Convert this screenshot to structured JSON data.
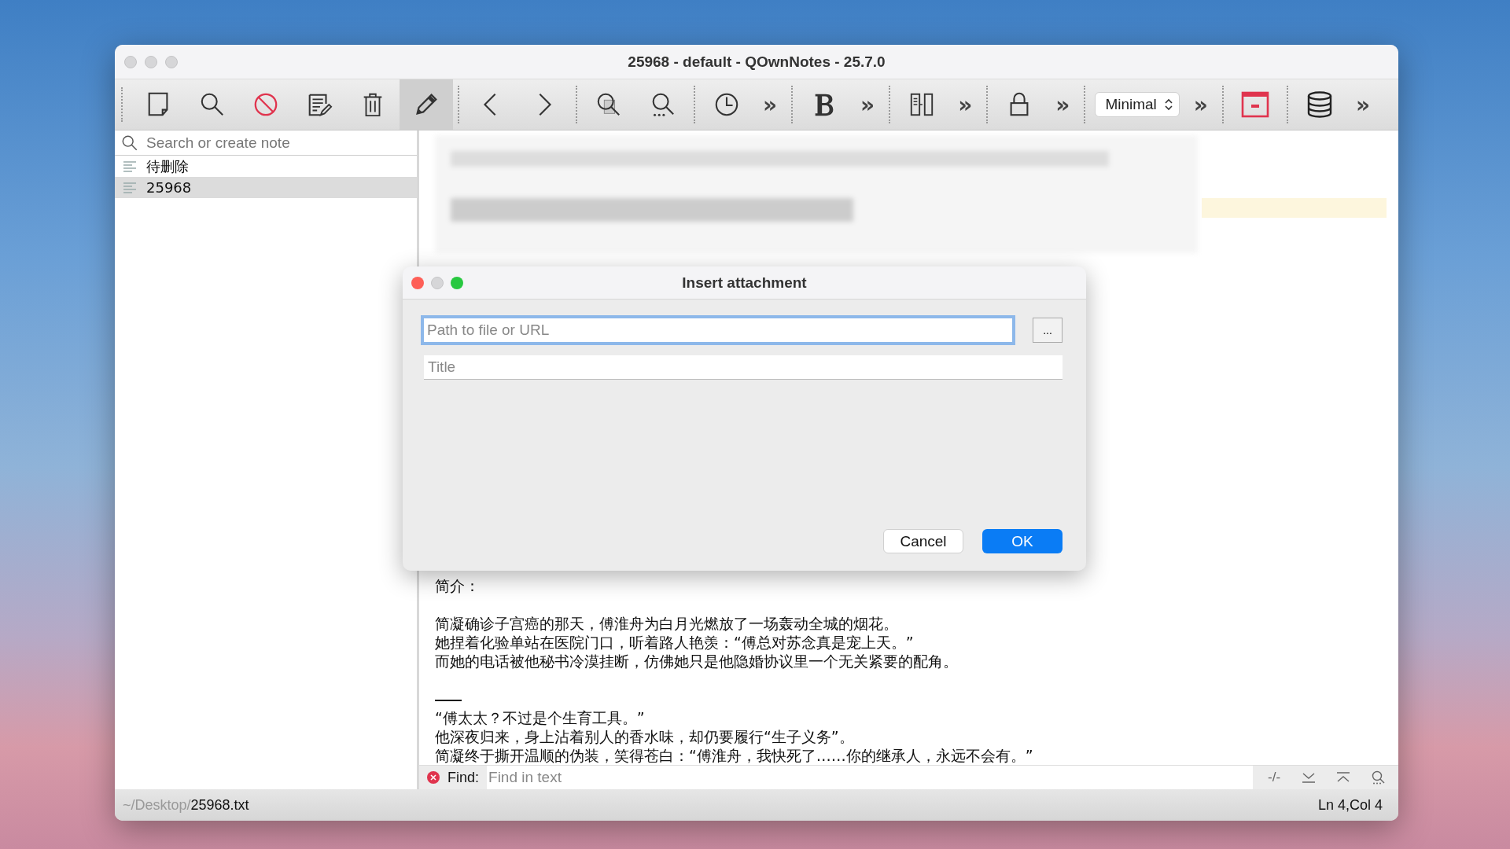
{
  "window": {
    "title": "25968 - default - QOwnNotes - 25.7.0"
  },
  "toolbar": {
    "edit_mode_active": true,
    "overflow": [
      "»",
      "»",
      "»",
      "»",
      "»",
      "»"
    ],
    "layout_select": "Minimal"
  },
  "sidebar": {
    "search": {
      "placeholder": "Search or create note"
    },
    "notes": [
      {
        "name": "待删除",
        "selected": false
      },
      {
        "name": "25968",
        "selected": true
      }
    ]
  },
  "editor": {
    "lines": [
      {
        "kind": "text",
        "text": "简介："
      },
      {
        "kind": "blank"
      },
      {
        "kind": "text",
        "text": "简凝确诊子宫癌的那天，傅淮舟为白月光燃放了一场轰动全城的烟花。"
      },
      {
        "kind": "text",
        "text": "她捏着化验单站在医院门口，听着路人艳羡：“傅总对苏念真是宠上天。”"
      },
      {
        "kind": "text",
        "text": "而她的电话被他秘书冷漠挂断，仿佛她只是他隐婚协议里一个无关紧要的配角。"
      },
      {
        "kind": "blank"
      },
      {
        "kind": "rule"
      },
      {
        "kind": "text",
        "text": "“傅太太？不过是个生育工具。”"
      },
      {
        "kind": "text",
        "text": "他深夜归来，身上沾着别人的香水味，却仍要履行“生子义务”。"
      },
      {
        "kind": "text",
        "text": "简凝终于撕开温顺的伪装，笑得苍白：“傅淮舟，我快死了……你的继承人，永远不会有。”"
      }
    ],
    "find_bar": {
      "label": "Find:",
      "placeholder": "Find in text",
      "whole_word": "-/-"
    }
  },
  "status_bar": {
    "path_dir": "~/Desktop/",
    "path_file": "25968.txt",
    "position": "Ln 4,Col 4"
  },
  "dialog": {
    "title": "Insert attachment",
    "path_placeholder": "Path to file or URL",
    "path_focused": true,
    "title_placeholder": "Title",
    "browse": "...",
    "cancel": "Cancel",
    "ok": "OK"
  }
}
